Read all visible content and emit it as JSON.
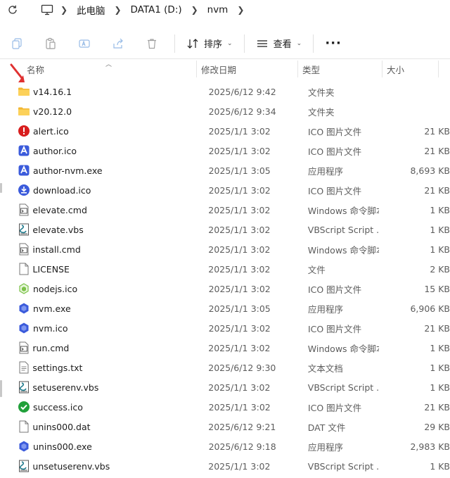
{
  "breadcrumb": {
    "items": [
      "此电脑",
      "DATA1 (D:)",
      "nvm"
    ]
  },
  "toolbar": {
    "sort_label": "排序",
    "view_label": "查看",
    "more_label": "···"
  },
  "columns": {
    "name": "名称",
    "date": "修改日期",
    "type": "类型",
    "size": "大小"
  },
  "files": [
    {
      "name": "v14.16.1",
      "date": "2025/6/12 9:42",
      "type": "文件夹",
      "size": "",
      "icon": "folder-icon"
    },
    {
      "name": "v20.12.0",
      "date": "2025/6/12 9:34",
      "type": "文件夹",
      "size": "",
      "icon": "folder-icon"
    },
    {
      "name": "alert.ico",
      "date": "2025/1/1 3:02",
      "type": "ICO 图片文件",
      "size": "21 KB",
      "icon": "alert-icon"
    },
    {
      "name": "author.ico",
      "date": "2025/1/1 3:02",
      "type": "ICO 图片文件",
      "size": "21 KB",
      "icon": "author-icon"
    },
    {
      "name": "author-nvm.exe",
      "date": "2025/1/1 3:05",
      "type": "应用程序",
      "size": "8,693 KB",
      "icon": "author-icon"
    },
    {
      "name": "download.ico",
      "date": "2025/1/1 3:02",
      "type": "ICO 图片文件",
      "size": "21 KB",
      "icon": "download-icon"
    },
    {
      "name": "elevate.cmd",
      "date": "2025/1/1 3:02",
      "type": "Windows 命令脚本",
      "size": "1 KB",
      "icon": "cmd-file-icon"
    },
    {
      "name": "elevate.vbs",
      "date": "2025/1/1 3:02",
      "type": "VBScript Script ...",
      "size": "1 KB",
      "icon": "vbs-file-icon"
    },
    {
      "name": "install.cmd",
      "date": "2025/1/1 3:02",
      "type": "Windows 命令脚本",
      "size": "1 KB",
      "icon": "cmd-file-icon"
    },
    {
      "name": "LICENSE",
      "date": "2025/1/1 3:02",
      "type": "文件",
      "size": "2 KB",
      "icon": "blank-file-icon"
    },
    {
      "name": "nodejs.ico",
      "date": "2025/1/1 3:02",
      "type": "ICO 图片文件",
      "size": "15 KB",
      "icon": "nodejs-icon"
    },
    {
      "name": "nvm.exe",
      "date": "2025/1/1 3:05",
      "type": "应用程序",
      "size": "6,906 KB",
      "icon": "nvm-icon"
    },
    {
      "name": "nvm.ico",
      "date": "2025/1/1 3:02",
      "type": "ICO 图片文件",
      "size": "21 KB",
      "icon": "nvm-icon"
    },
    {
      "name": "run.cmd",
      "date": "2025/1/1 3:02",
      "type": "Windows 命令脚本",
      "size": "1 KB",
      "icon": "cmd-file-icon"
    },
    {
      "name": "settings.txt",
      "date": "2025/6/12 9:30",
      "type": "文本文档",
      "size": "1 KB",
      "icon": "text-file-icon"
    },
    {
      "name": "setuserenv.vbs",
      "date": "2025/1/1 3:02",
      "type": "VBScript Script ...",
      "size": "1 KB",
      "icon": "vbs-file-icon"
    },
    {
      "name": "success.ico",
      "date": "2025/1/1 3:02",
      "type": "ICO 图片文件",
      "size": "21 KB",
      "icon": "success-icon"
    },
    {
      "name": "unins000.dat",
      "date": "2025/6/12 9:21",
      "type": "DAT 文件",
      "size": "29 KB",
      "icon": "blank-file-icon"
    },
    {
      "name": "unins000.exe",
      "date": "2025/6/12 9:18",
      "type": "应用程序",
      "size": "2,983 KB",
      "icon": "nvm-icon"
    },
    {
      "name": "unsetuserenv.vbs",
      "date": "2025/1/1 3:02",
      "type": "VBScript Script ...",
      "size": "1 KB",
      "icon": "vbs-file-icon"
    }
  ],
  "colors": {
    "folder": "#f5c542",
    "accent_blue": "#3b5bdb",
    "alert_red": "#d81e1e",
    "success_green": "#21a03a",
    "nodejs_green": "#7cc24a",
    "annotation_arrow": "#e03131"
  }
}
